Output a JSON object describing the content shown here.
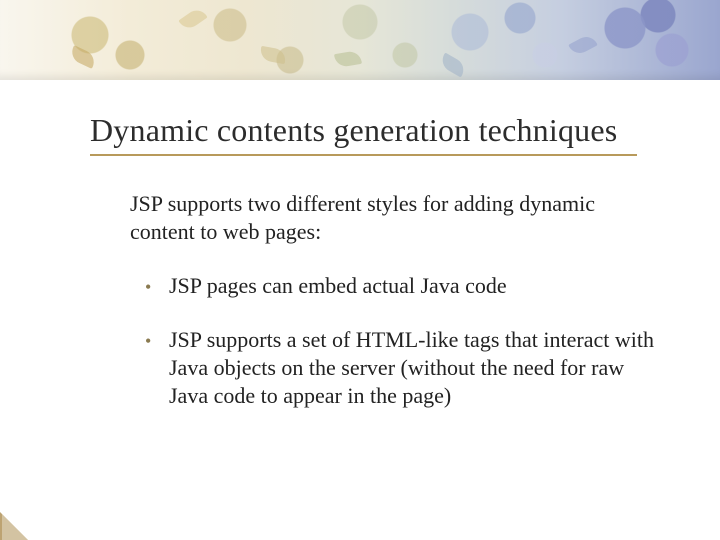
{
  "title": "Dynamic contents generation techniques",
  "intro": "JSP supports two different styles for adding dynamic content to web pages:",
  "bullets": [
    "JSP pages can embed actual Java code",
    "JSP supports a set of HTML-like tags that interact with Java objects on the server (without the need for raw Java code to appear in the page)"
  ]
}
